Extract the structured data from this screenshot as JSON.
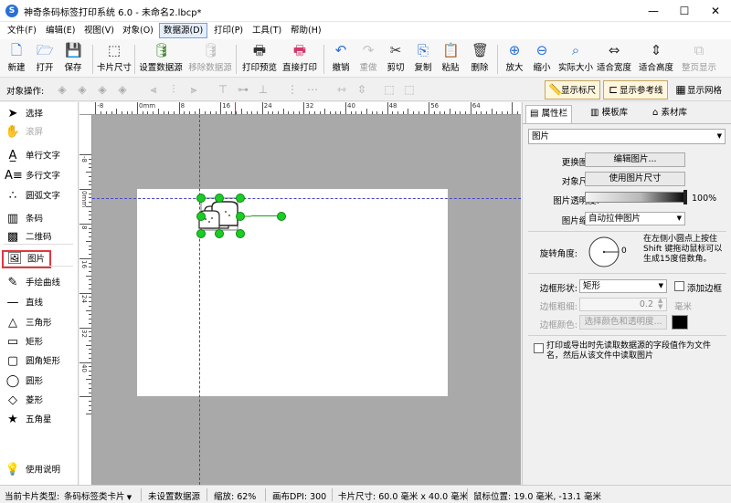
{
  "app": {
    "title": "神奇条码标签打印系统 6.0 - 未命名2.lbcp*",
    "icon_letter": "S",
    "window_buttons": [
      "—",
      "☐",
      "✕"
    ]
  },
  "menu": [
    "文件(F)",
    "编辑(E)",
    "视图(V)",
    "对象(O)",
    "数据源(D)",
    "打印(P)",
    "工具(T)",
    "帮助(H)"
  ],
  "toolbar": [
    {
      "label": "新建",
      "icon": "new-file-icon",
      "glyph": "🗋",
      "color": "#2a6fd6"
    },
    {
      "label": "打开",
      "icon": "open-folder-icon",
      "glyph": "🗁",
      "color": "#2a6fd6"
    },
    {
      "label": "保存",
      "icon": "save-icon",
      "glyph": "💾",
      "color": "#2a6fd6"
    },
    {
      "label": "卡片尺寸",
      "icon": "card-size-icon",
      "glyph": "⬚",
      "color": "#333333"
    },
    {
      "label": "设置数据源",
      "icon": "database-icon",
      "glyph": "🛢",
      "color": "#4a8a3a"
    },
    {
      "label": "移除数据源",
      "icon": "remove-database-icon",
      "glyph": "🛢",
      "color": "#888888",
      "disabled": true
    },
    {
      "label": "打印预览",
      "icon": "print-preview-icon",
      "glyph": "🖶",
      "color": "#333333"
    },
    {
      "label": "直接打印",
      "icon": "print-icon",
      "glyph": "🖶",
      "color": "#d03a6a"
    },
    {
      "label": "撤销",
      "icon": "undo-icon",
      "glyph": "↶",
      "color": "#2a6fd6"
    },
    {
      "label": "重做",
      "icon": "redo-icon",
      "glyph": "↷",
      "color": "#888888",
      "disabled": true
    },
    {
      "label": "剪切",
      "icon": "cut-icon",
      "glyph": "✂",
      "color": "#333333"
    },
    {
      "label": "复制",
      "icon": "copy-icon",
      "glyph": "⎘",
      "color": "#2a6fd6"
    },
    {
      "label": "粘贴",
      "icon": "paste-icon",
      "glyph": "📋",
      "color": "#333333"
    },
    {
      "label": "删除",
      "icon": "delete-icon",
      "glyph": "🗑",
      "color": "#333333"
    },
    {
      "label": "放大",
      "icon": "zoom-in-icon",
      "glyph": "⊕",
      "color": "#2a6fd6"
    },
    {
      "label": "缩小",
      "icon": "zoom-out-icon",
      "glyph": "⊖",
      "color": "#2a6fd6"
    },
    {
      "label": "实际大小",
      "icon": "actual-size-icon",
      "glyph": "⌕",
      "color": "#2a6fd6"
    },
    {
      "label": "适合宽度",
      "icon": "fit-width-icon",
      "glyph": "⇔",
      "color": "#333333"
    },
    {
      "label": "适合高度",
      "icon": "fit-height-icon",
      "glyph": "⇕",
      "color": "#333333"
    },
    {
      "label": "整页显示",
      "icon": "full-page-icon",
      "glyph": "⧉",
      "color": "#888888",
      "disabled": true
    }
  ],
  "object_bar": {
    "label": "对象操作:",
    "toggles": [
      {
        "label": "显示标尺",
        "icon": "ruler-icon",
        "glyph": "📏",
        "on": true
      },
      {
        "label": "显示参考线",
        "icon": "guideline-icon",
        "glyph": "⊏",
        "on": true
      },
      {
        "label": "显示网格",
        "icon": "grid-icon",
        "glyph": "▦",
        "on": false
      }
    ]
  },
  "left_tools": [
    {
      "label": "选择",
      "icon": "pointer-icon",
      "glyph": "➤"
    },
    {
      "label": "滚屏",
      "icon": "hand-icon",
      "glyph": "✋",
      "disabled": true
    },
    {
      "label": "单行文字",
      "icon": "single-line-text-icon",
      "glyph": "A̲"
    },
    {
      "label": "多行文字",
      "icon": "multi-line-text-icon",
      "glyph": "A≡"
    },
    {
      "label": "圆弧文字",
      "icon": "arc-text-icon",
      "glyph": "∴"
    },
    {
      "label": "条码",
      "icon": "barcode-icon",
      "glyph": "▥"
    },
    {
      "label": "二维码",
      "icon": "qrcode-icon",
      "glyph": "▩"
    },
    {
      "label": "图片",
      "icon": "picture-icon",
      "glyph": "🖼",
      "selected": true
    },
    {
      "label": "手绘曲线",
      "icon": "freehand-icon",
      "glyph": "✎"
    },
    {
      "label": "直线",
      "icon": "line-icon",
      "glyph": "—"
    },
    {
      "label": "三角形",
      "icon": "triangle-icon",
      "glyph": "△"
    },
    {
      "label": "矩形",
      "icon": "rectangle-icon",
      "glyph": "▭"
    },
    {
      "label": "圆角矩形",
      "icon": "rounded-rect-icon",
      "glyph": "▢"
    },
    {
      "label": "圆形",
      "icon": "circle-icon",
      "glyph": "◯"
    },
    {
      "label": "菱形",
      "icon": "diamond-icon",
      "glyph": "◇"
    },
    {
      "label": "五角星",
      "icon": "star-icon",
      "glyph": "★"
    },
    {
      "label": "使用说明",
      "icon": "lightbulb-icon",
      "glyph": "💡"
    }
  ],
  "ruler": {
    "h_labels": [
      "-8",
      "0mm",
      "8",
      "16",
      "24",
      "32",
      "40",
      "48",
      "56",
      "64",
      "72"
    ],
    "v_labels": [
      "-8",
      "0mm",
      "8",
      "16",
      "24",
      "32",
      "40"
    ]
  },
  "right_panel": {
    "tabs": [
      "属性栏",
      "模板库",
      "素材库"
    ],
    "object_type": "图片",
    "change_image_label": "更换图片:",
    "edit_image_btn": "编辑图片...",
    "object_size_label": "对象尺寸:",
    "use_image_size_btn": "使用图片尺寸",
    "opacity_label": "图片透明度:",
    "opacity_value": "100%",
    "scale_label": "图片缩放:",
    "scale_value": "自动拉伸图片",
    "rotate_label": "旋转角度:",
    "rotate_value": "0",
    "rotate_hint": "在左侧小圆点上按住Shift 键拖动鼠标可以生成15度倍数角。",
    "border_shape_label": "边框形状:",
    "border_shape_value": "矩形",
    "add_border_label": "添加边框",
    "border_width_label": "边框粗细:",
    "border_width_value": "0.2",
    "border_width_unit": "毫米",
    "border_color_label": "边框颜色:",
    "border_color_btn": "选择颜色和透明度...",
    "border_color_value": "#000000",
    "read_from_datasource": "打印或导出时先读取数据源的字段值作为文件名，然后从该文件中读取图片"
  },
  "status": {
    "card_type_label": "当前卡片类型:",
    "card_type_value": "条码标签类卡片",
    "datasource": "未设置数据源",
    "zoom": "缩放: 62%",
    "dpi": "画布DPI: 300",
    "card_size": "卡片尺寸: 60.0 毫米 x 40.0 毫米",
    "mouse_pos": "鼠标位置: 19.0 毫米, -13.1 毫米"
  }
}
